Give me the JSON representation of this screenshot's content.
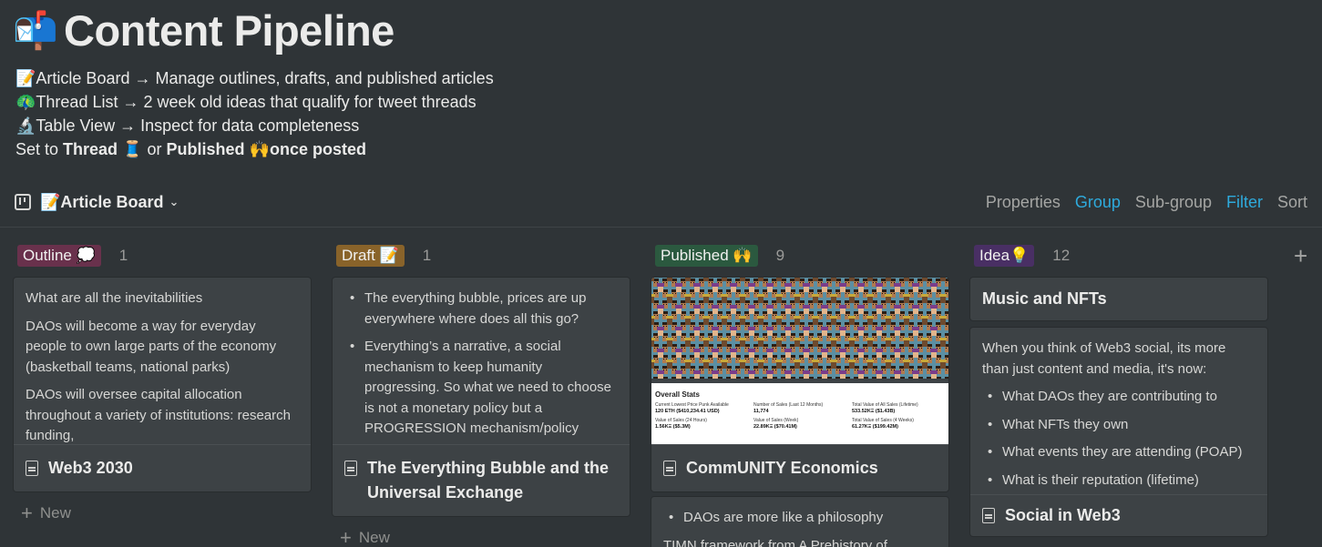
{
  "header": {
    "icon": "📬",
    "title": "Content Pipeline"
  },
  "description": {
    "line1": {
      "icon": "📝",
      "text": "Article Board → Manage outlines, drafts, and published articles"
    },
    "line2": {
      "icon": "🦚",
      "text": "Thread List → 2 week old ideas that qualify for tweet threads"
    },
    "line3": {
      "icon": "🔬",
      "text": "Table View → Inspect for data completeness"
    },
    "line4": {
      "prefix": "Set to ",
      "thread": "Thread",
      "thread_icon": "🧵",
      "middle": " or ",
      "published": "Published",
      "published_icon": "🙌",
      "suffix": "once posted"
    }
  },
  "viewbar": {
    "view_icon": "📝",
    "view_name": "Article Board",
    "actions": {
      "properties": "Properties",
      "group": "Group",
      "subgroup": "Sub-group",
      "filter": "Filter",
      "sort": "Sort"
    }
  },
  "colors": {
    "outline": "#69314c",
    "draft": "#89632a",
    "published": "#2b593f",
    "idea": "#492f64",
    "accent": "#2eaadc"
  },
  "columns": {
    "outline": {
      "label": "Outline 💭",
      "count": "1",
      "card": {
        "preview": [
          "What are all the inevitabilities",
          "DAOs will become a way for everyday people to own large parts of the economy (basketball teams, national parks)",
          "DAOs will oversee capital allocation throughout a variety of institutions: research funding,"
        ],
        "title": "Web3 2030"
      },
      "new_label": "New"
    },
    "draft": {
      "label": "Draft 📝",
      "count": "1",
      "card": {
        "bullets": [
          "The everything bubble, prices are up everywhere where does all this go?",
          "Everything’s a narrative, a social mechanism to keep humanity progressing. So what we need to choose is not a monetary policy but a PROGRESSION mechanism/policy"
        ],
        "title": "The Everything Bubble and the Universal Exchange"
      },
      "new_label": "New"
    },
    "published": {
      "label": "Published 🙌",
      "count": "9",
      "card1": {
        "stats_title": "Overall Stats",
        "stats": [
          {
            "label": "Current Lowest Price Punk Available",
            "value": "120 ETH ($410,234.41 USD)"
          },
          {
            "label": "Number of Sales (Last 12 Months)",
            "value": "11,774"
          },
          {
            "label": "Total Value of All Sales (Lifetime)",
            "value": "533.52KΞ ($1.43B)"
          },
          {
            "label": "Value of Sales (24 Hours)",
            "value": "1.56KΞ ($5.3M)"
          },
          {
            "label": "Value of Sales (Week)",
            "value": "22.89KΞ ($70.41M)"
          },
          {
            "label": "Total Value of Sales (4 Weeks)",
            "value": "61.27KΞ ($199.42M)"
          }
        ],
        "title": "CommUNITY Economics"
      },
      "card2": {
        "bullet": "DAOs are more like a philosophy",
        "text": "TIMN framework from A Prehistory of"
      }
    },
    "idea": {
      "label": "Idea💡",
      "count": "12",
      "card1": {
        "title": "Music and NFTs"
      },
      "card2": {
        "intro": "When you think of Web3 social, its more than just content and media, it's now:",
        "bullets": [
          "What DAOs they are contributing to",
          "What NFTs they own",
          "What events they are attending (POAP)",
          "What is their reputation (lifetime)"
        ],
        "title": "Social in Web3"
      }
    }
  }
}
